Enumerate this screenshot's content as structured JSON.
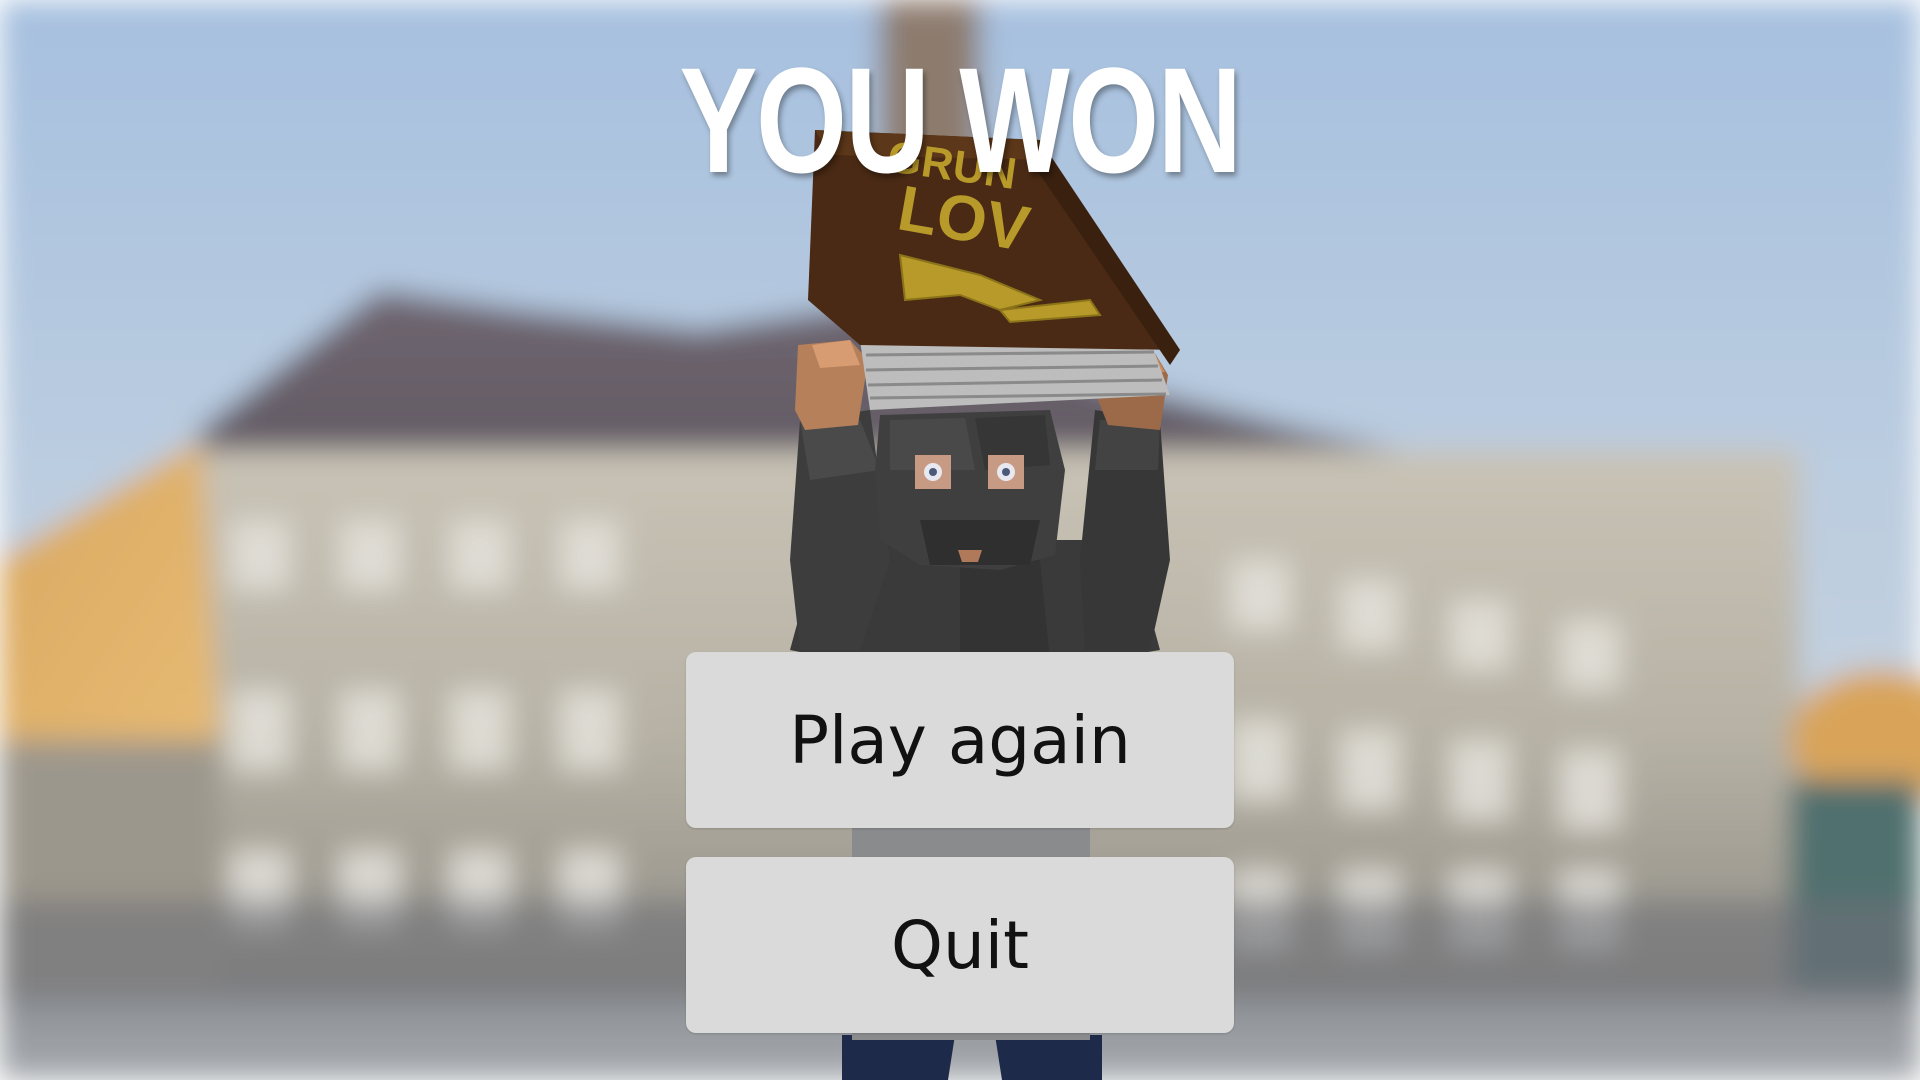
{
  "screen": {
    "title": "YOU WON"
  },
  "menu": {
    "play_again_label": "Play again",
    "quit_label": "Quit"
  },
  "book": {
    "cover_text_top": "GRUN",
    "cover_text_mid": "LOV"
  },
  "colors": {
    "sky_top": "#a9c2df",
    "sky_bottom": "#c8d6e4",
    "button_bg": "#dadada",
    "button_text": "#111111",
    "title_text": "#ffffff",
    "book_cover": "#4a2a14",
    "book_gold": "#b89a2a",
    "character_body": "#3e3e3e",
    "character_skin": "#b5805a",
    "trousers": "#1e2a4a"
  }
}
